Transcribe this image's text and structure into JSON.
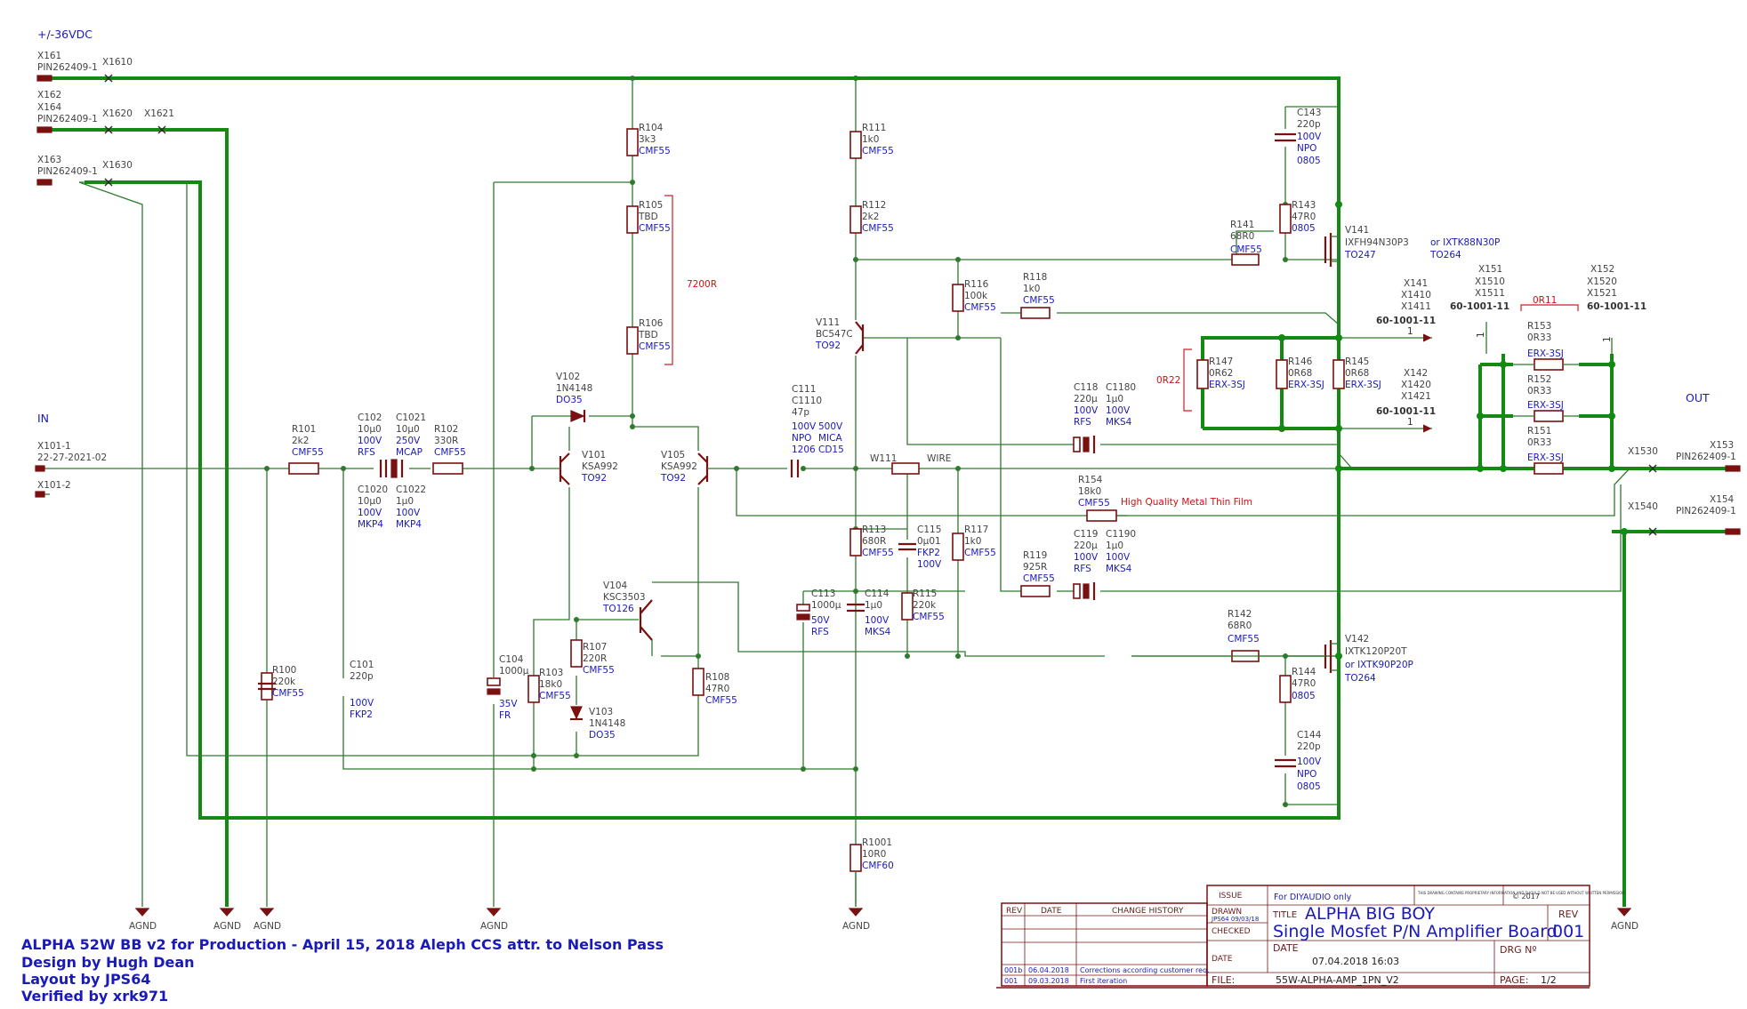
{
  "header": {
    "supply_label": "+/-36VDC",
    "in_label": "IN",
    "out_label": "OUT"
  },
  "connectors": {
    "x161": "X161",
    "x161_pin": "PIN262409-1",
    "x1610": "X1610",
    "x162": "X162",
    "x164": "X164",
    "x162_pin": "PIN262409-1",
    "x1620": "X1620",
    "x1621": "X1621",
    "x163": "X163",
    "x163_pin": "PIN262409-1",
    "x1630": "X1630",
    "x101_1": "X101-1",
    "x101_1_part": "22-27-2021-02",
    "x101_2": "X101-2",
    "x141": "X141",
    "x1410": "X1410",
    "x1411": "X1411",
    "x141_part": "60-1001-11",
    "x141_pin": "1",
    "x142": "X142",
    "x1420": "X1420",
    "x1421": "X1421",
    "x142_part": "60-1001-11",
    "x142_pin": "1",
    "x151": "X151",
    "x1510": "X1510",
    "x1511": "X1511",
    "x151_part": "60-1001-11",
    "x151_pin": "1",
    "x152": "X152",
    "x1520": "X1520",
    "x1521": "X1521",
    "x152_part": "60-1001-11",
    "x152_pin": "1",
    "x153": "X153",
    "x153_pin": "PIN262409-1",
    "x1530": "X1530",
    "x154": "X154",
    "x154_pin": "PIN262409-1",
    "x1540": "X1540"
  },
  "grounds": {
    "agnd": "AGND"
  },
  "components": {
    "r101": [
      "R101",
      "2k2",
      "CMF55"
    ],
    "r100": [
      "R100",
      "220k",
      "CMF55"
    ],
    "c102": [
      "C102",
      "10µ0",
      "100V",
      "RFS"
    ],
    "c1021": [
      "C1021",
      "10µ0",
      "250V",
      "MCAP"
    ],
    "c1020": [
      "C1020",
      "10µ0",
      "100V",
      "MKP4"
    ],
    "c1022": [
      "C1022",
      "1µ0",
      "100V",
      "MKP4"
    ],
    "r102": [
      "R102",
      "330R",
      "CMF55"
    ],
    "c101": [
      "C101",
      "220p",
      "100V",
      "FKP2"
    ],
    "c104": [
      "C104",
      "1000µ",
      "35V",
      "FR"
    ],
    "r103": [
      "R103",
      "18k0",
      "CMF55"
    ],
    "r104": [
      "R104",
      "3k3",
      "CMF55"
    ],
    "r105": [
      "R105",
      "TBD",
      "CMF55"
    ],
    "r106": [
      "R106",
      "TBD",
      "CMF55"
    ],
    "bracket_7200": "7200R",
    "v102": [
      "V102",
      "1N4148",
      "DO35"
    ],
    "v101": [
      "V101",
      "KSA992",
      "TO92"
    ],
    "v105": [
      "V105",
      "KSA992",
      "TO92"
    ],
    "v104": [
      "V104",
      "KSC3503",
      "TO126"
    ],
    "r107": [
      "R107",
      "220R",
      "CMF55"
    ],
    "v103": [
      "V103",
      "1N4148",
      "DO35"
    ],
    "r108": [
      "R108",
      "47R0",
      "CMF55"
    ],
    "c111": [
      "C111",
      "C1110",
      "47p",
      "100V",
      "500V",
      "NPO",
      "MICA",
      "1206",
      "CD15"
    ],
    "w111": [
      "W111",
      "WIRE"
    ],
    "r111": [
      "R111",
      "1k0",
      "CMF55"
    ],
    "r112": [
      "R112",
      "2k2",
      "CMF55"
    ],
    "v111": [
      "V111",
      "BC547C",
      "TO92"
    ],
    "r116": [
      "R116",
      "100k",
      "CMF55"
    ],
    "r118": [
      "R118",
      "1k0",
      "CMF55"
    ],
    "r113": [
      "R113",
      "680R",
      "CMF55"
    ],
    "c115": [
      "C115",
      "0µ01",
      "FKP2",
      "100V"
    ],
    "r117": [
      "R117",
      "1k0",
      "CMF55"
    ],
    "c113": [
      "C113",
      "1000µ",
      "50V",
      "RFS"
    ],
    "c114": [
      "C114",
      "1µ0",
      "100V",
      "MKS4"
    ],
    "r115": [
      "R115",
      "220k",
      "CMF55"
    ],
    "r1001": [
      "R1001",
      "10R0",
      "CMF60"
    ],
    "r119": [
      "R119",
      "925R",
      "CMF55"
    ],
    "c118": [
      "C118",
      "C1180",
      "220µ",
      "1µ0",
      "100V",
      "100V",
      "RFS",
      "MKS4"
    ],
    "c119": [
      "C119",
      "C1190",
      "220µ",
      "1µ0",
      "100V",
      "100V",
      "RFS",
      "MKS4"
    ],
    "r154": [
      "R154",
      "18k0",
      "CMF55"
    ],
    "r154_note": "High Quality Metal Thin Film",
    "c143": [
      "C143",
      "220p",
      "100V",
      "NPO",
      "0805"
    ],
    "r143": [
      "R143",
      "47R0",
      "0805"
    ],
    "r141": [
      "R141",
      "68R0",
      "CMF55"
    ],
    "v141": [
      "V141",
      "IXFH94N30P3",
      "TO247"
    ],
    "v141_alt": [
      "or IXTK88N30P",
      "TO264"
    ],
    "r147": [
      "R147",
      "0R62",
      "ERX-3SJ"
    ],
    "r146": [
      "R146",
      "0R68",
      "ERX-3SJ"
    ],
    "r145": [
      "R145",
      "0R68",
      "ERX-3SJ"
    ],
    "bracket_0r22": "0R22",
    "r153": [
      "R153",
      "0R33",
      "ERX-3SJ"
    ],
    "r152": [
      "R152",
      "0R33",
      "ERX-3SJ"
    ],
    "r151": [
      "R151",
      "0R33",
      "ERX-3SJ"
    ],
    "bracket_0r11": "0R11",
    "r142": [
      "R142",
      "68R0",
      "CMF55"
    ],
    "v142": [
      "V142",
      "IXTK120P20T",
      "or IXTK90P20P",
      "TO264"
    ],
    "r144": [
      "R144",
      "47R0",
      "0805"
    ],
    "c144": [
      "C144",
      "220p",
      "100V",
      "NPO",
      "0805"
    ]
  },
  "footer": {
    "line1": "ALPHA 52W BB v2 for Production  -  April 15, 2018   Aleph CCS attr. to Nelson Pass",
    "line2": "Design by Hugh Dean",
    "line3": "Layout by JPS64",
    "line4": "Verified by xrk971"
  },
  "title_block": {
    "rev_hdr": "REV",
    "date_hdr": "DATE",
    "history_hdr": "CHANGE HISTORY",
    "rows": [
      {
        "rev": "001b",
        "date": "06.04.2018",
        "change": "Corrections according customer req."
      },
      {
        "rev": "001",
        "date": "09.03.2018",
        "change": "First iteration"
      }
    ],
    "issue": "ISSUE",
    "issue_val": "For DIYAUDIO only",
    "notice": "THIS DRAWING CONTAINS PROPRIETARY INFORMATION AND SHOULD NOT BE USED WITHOUT WRITTEN PERMISSION.",
    "copyright": "© 2017",
    "drawn": "DRAWN",
    "drawn_val": "JPS64 09/03/18",
    "checked": "CHECKED",
    "date_lbl": "DATE",
    "title_lbl": "TITLE",
    "title1": "ALPHA BIG BOY",
    "title2": "Single Mosfet P/N Amplifier Board",
    "rev_lbl": "REV",
    "rev_val": "001",
    "date2": "DATE",
    "date_val": "07.04.2018 16:03",
    "drg": "DRG Nº",
    "file_lbl": "FILE:",
    "file_val": "55W-ALPHA-AMP_1PN_V2",
    "page_lbl": "PAGE:",
    "page_val": "1/2"
  }
}
